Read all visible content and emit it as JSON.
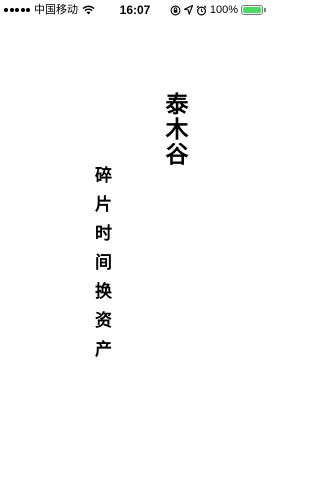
{
  "status_bar": {
    "carrier": "中国移动",
    "time": "16:07",
    "battery_percent": "100%",
    "battery_level": 1.0,
    "icons": [
      "signal-dots-icon",
      "wifi-icon",
      "orientation-lock-icon",
      "location-icon",
      "alarm-icon",
      "battery-icon"
    ],
    "battery_color": "#4cd964"
  },
  "main": {
    "brand": "泰木谷",
    "slogan": "碎片时间换资产"
  }
}
